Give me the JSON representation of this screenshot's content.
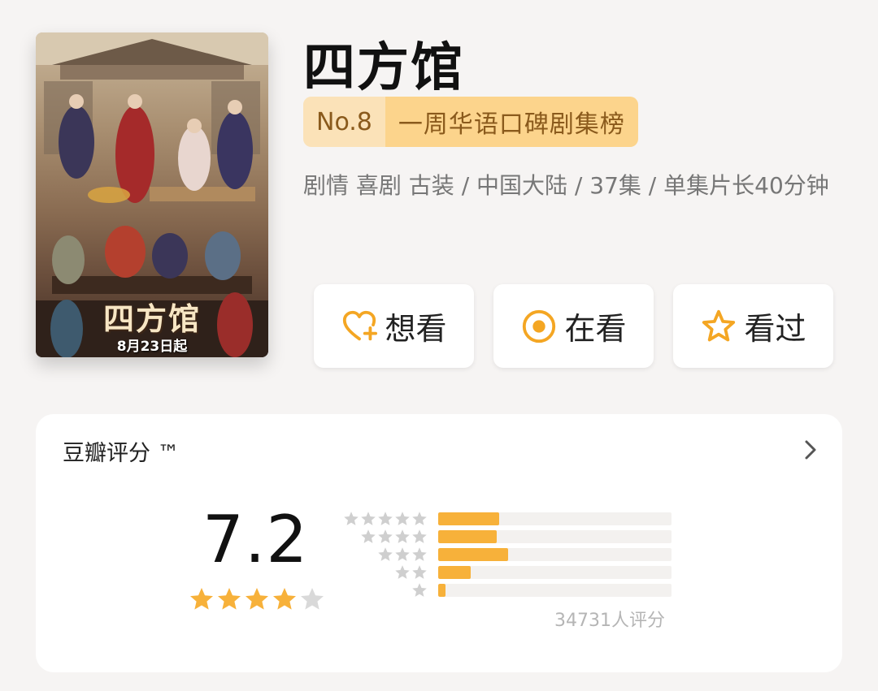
{
  "poster": {
    "title": "四方馆",
    "date": "8月23日起"
  },
  "title": "四方馆",
  "rank": {
    "number": "No.8",
    "label": "一周华语口碑剧集榜"
  },
  "meta": "剧情 喜剧 古装 / 中国大陆 / 37集 / 单集片长40分钟",
  "actions": [
    {
      "label": "想看",
      "icon": "heart-plus-icon"
    },
    {
      "label": "在看",
      "icon": "target-circle-icon"
    },
    {
      "label": "看过",
      "icon": "star-outline-icon"
    }
  ],
  "rating": {
    "heading": "豆瓣评分 ™",
    "score": "7.2",
    "stars": 4,
    "distribution": [
      {
        "stars": 5,
        "fraction": 0.26
      },
      {
        "stars": 4,
        "fraction": 0.25
      },
      {
        "stars": 3,
        "fraction": 0.3
      },
      {
        "stars": 2,
        "fraction": 0.14
      },
      {
        "stars": 1,
        "fraction": 0.03
      }
    ],
    "raters": "34731人评分"
  },
  "colors": {
    "accent": "#f7b13a",
    "rank_bg": "#fcd48c",
    "rank_text": "#8a5a1c",
    "star_empty": "#d9d9d9"
  }
}
